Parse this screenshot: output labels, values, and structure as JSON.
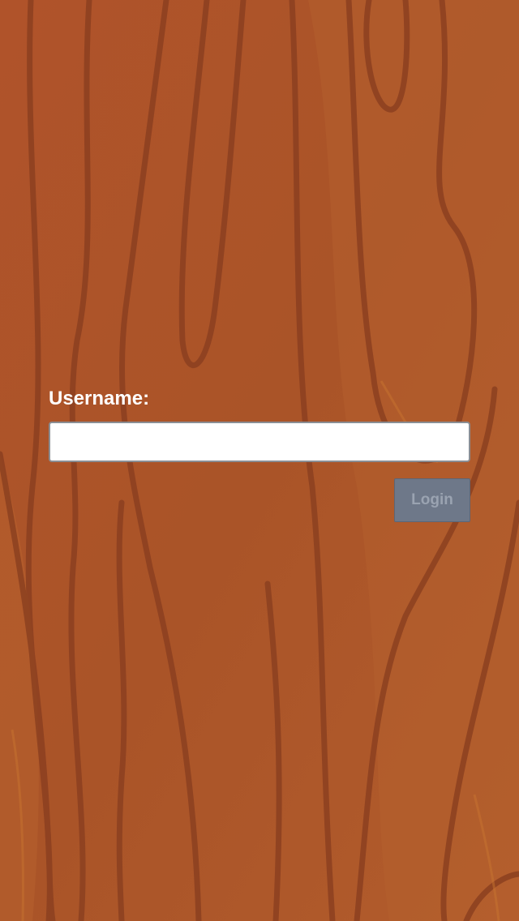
{
  "form": {
    "username_label": "Username:",
    "username_value": "",
    "username_placeholder": "",
    "login_label": "Login",
    "login_state": "disabled"
  },
  "theme": {
    "background_base": "#b0562a",
    "grain_color": "#8c4020",
    "highlight_color": "#c0692f",
    "label_color": "#ffffff",
    "button_bg": "#6e7889",
    "button_text": "#9aa3b1"
  },
  "background": {
    "pattern": "wood-grain"
  }
}
